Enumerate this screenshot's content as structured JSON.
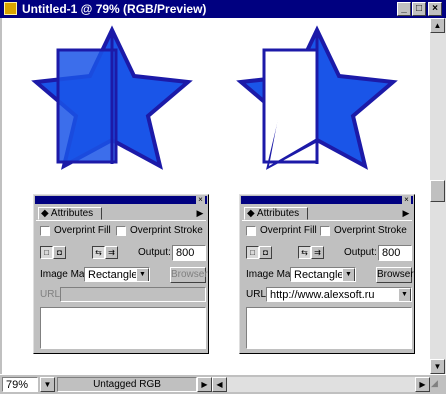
{
  "window": {
    "title": "Untitled-1 @ 79% (RGB/Preview)",
    "minimize": "_",
    "maximize": "□",
    "close": "×"
  },
  "colors": {
    "star_fill": "#1a55e8",
    "star_stroke": "#1c1aa8",
    "titlebar": "#000080"
  },
  "palette_left": {
    "tab_label": "Attributes",
    "overprint_fill": "Overprint Fill",
    "overprint_stroke": "Overprint Stroke",
    "output_label": "Output:",
    "output_value": "800",
    "image_map_label": "Image Map:",
    "image_map_value": "Rectangle",
    "browser_label": "Browser",
    "url_label": "URL:",
    "url_value": ""
  },
  "palette_right": {
    "tab_label": "Attributes",
    "overprint_fill": "Overprint Fill",
    "overprint_stroke": "Overprint Stroke",
    "output_label": "Output:",
    "output_value": "800",
    "image_map_label": "Image Map:",
    "image_map_value": "Rectangle",
    "browser_label": "Browser",
    "url_label": "URL:",
    "url_value": "http://www.alexsoft.ru"
  },
  "status": {
    "zoom": "79%",
    "profile": "Untagged RGB"
  }
}
